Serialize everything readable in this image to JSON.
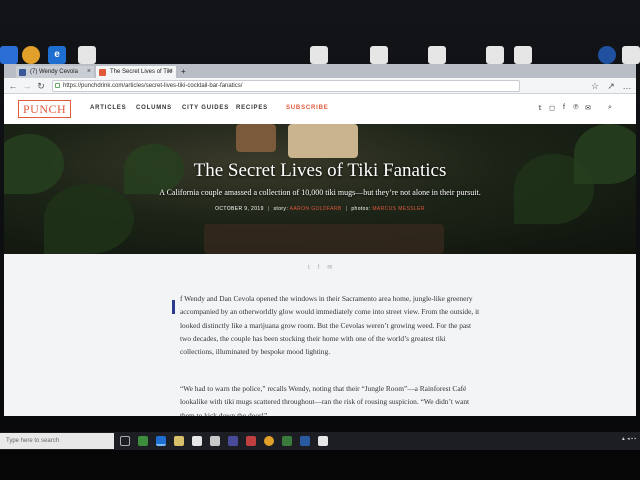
{
  "browser": {
    "tabs": [
      {
        "label": "(7) Wendy Cevola",
        "favicon_color": "#3b5998",
        "active": false
      },
      {
        "label": "The Secret Lives of Tiki ",
        "favicon_color": "#e05a3a",
        "active": true
      }
    ],
    "url": "https://punchdrink.com/articles/secret-lives-tiki-cocktail-bar-fanatics/"
  },
  "site": {
    "logo": "PUNCH",
    "nav": [
      "ARTICLES",
      "COLUMNS",
      "CITY GUIDES",
      "RECIPES"
    ],
    "subscribe": "SUBSCRIBE",
    "social_icons": [
      "twitter-icon",
      "instagram-icon",
      "facebook-icon",
      "pinterest-icon",
      "mail-icon"
    ]
  },
  "article": {
    "title": "The Secret Lives of Tiki Fanatics",
    "subtitle": "A California couple amassed a collection of 10,000 tiki mugs—but they’re not alone in their pursuit.",
    "date": "OCTOBER 9, 2019",
    "story_label": "story:",
    "author": "AARON GOLDFARB",
    "photos_label": "photos:",
    "photographer": "MARCUS MESSLER",
    "paragraphs": [
      "f Wendy and Dan Cevola opened the windows in their Sacramento area home, jungle-like greenery accompanied by an otherworldly glow would immediately come into street view. From the outside, it looked distinctly like a marijuana grow room. But the Cevolas weren’t growing weed. For the past two decades, the couple has been stocking their home with one of the world’s greatest tiki collections, illuminated by bespoke mood lighting.",
      "“We had to warn the police,” recalls Wendy, noting that their “Jungle Room”—a Rainforest Café lookalike with tiki mugs scattered throughout—ran the risk of rousing suspicion. “We didn’t want them to kick down the door!”"
    ]
  },
  "taskbar": {
    "search_placeholder": "Type here to search"
  },
  "colors": {
    "brand": "#e05a3a",
    "dropcap": "#2b3a8f"
  }
}
